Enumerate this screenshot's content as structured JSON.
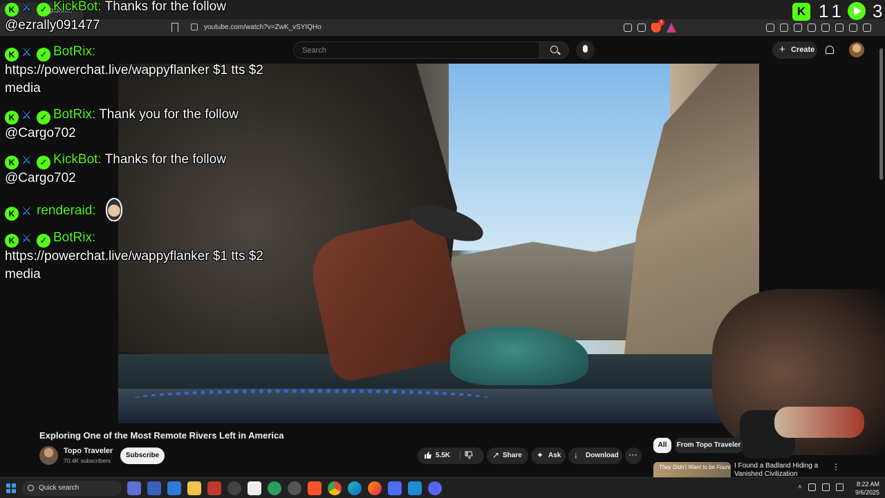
{
  "browser": {
    "tab_title": "Explorin...",
    "url": "youtube.com/watch?v=ZwK_vSYIQHo",
    "brave_badge": "1"
  },
  "youtube_header": {
    "search_placeholder": "Search",
    "create_label": "Create"
  },
  "video": {
    "title": "Exploring One of the Most Remote Rivers Left in America",
    "channel_name": "Topo Traveler",
    "subscribers": "70.4K subscribers",
    "subscribe_label": "Subscribe",
    "like_count": "5.5K",
    "share_label": "Share",
    "ask_label": "Ask",
    "download_label": "Download",
    "more_label": "···"
  },
  "sidebar": {
    "chips": [
      "All",
      "From Topo Traveler"
    ],
    "rec_thumb_text": "They Didn't Want to be Found",
    "rec_title": "I Found a Badland Hiding a Vanished Civilization"
  },
  "chat": {
    "messages": [
      {
        "user": "KickBot:",
        "text": "Thanks for the follow @ezrally091477"
      },
      {
        "user": "BotRix:",
        "text": "https://powerchat.live/wappyflanker $1 tts $2 media"
      },
      {
        "user": "BotRix:",
        "text": "Thank you for the follow @Cargo702"
      },
      {
        "user": "KickBot:",
        "text": "Thanks for the follow @Cargo702"
      },
      {
        "user": "renderaid:",
        "text": ""
      },
      {
        "user": "BotRix:",
        "text": "https://powerchat.live/wappyflanker $1 tts $2 media"
      }
    ]
  },
  "stream_stats": {
    "kick_count": "11",
    "play_count": "3"
  },
  "taskbar": {
    "search_label": "Quick search",
    "time": "8:22 AM",
    "date": "9/6/2025"
  },
  "colors": {
    "kick_green": "#53fc18",
    "yt_bg": "#0f0f0f",
    "taskbar_bg": "#202020"
  }
}
